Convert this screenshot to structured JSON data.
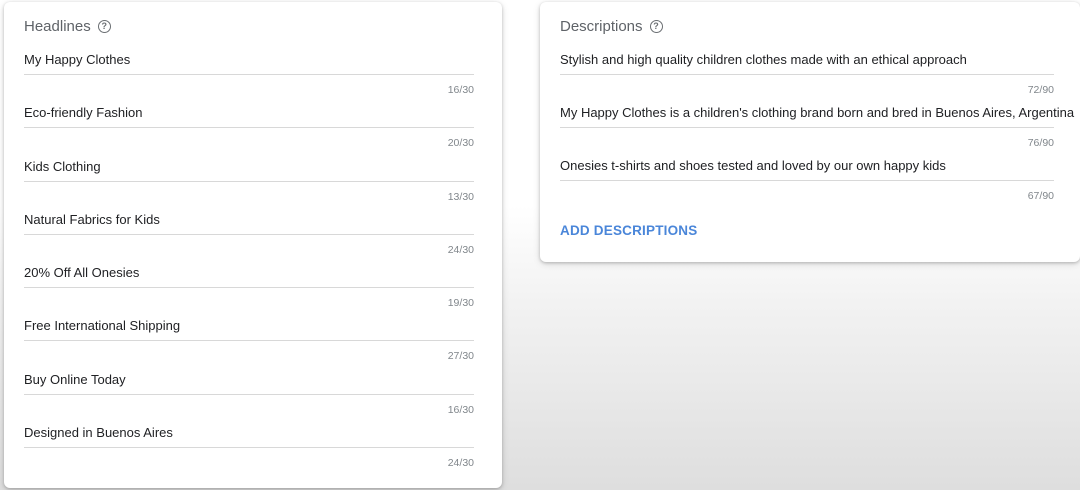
{
  "headlines": {
    "title": "Headlines",
    "help_icon": "help-circle-icon",
    "items": [
      {
        "text": "My Happy Clothes",
        "count": "16/30"
      },
      {
        "text": "Eco-friendly Fashion",
        "count": "20/30"
      },
      {
        "text": "Kids Clothing",
        "count": "13/30"
      },
      {
        "text": "Natural Fabrics for Kids",
        "count": "24/30"
      },
      {
        "text": "20% Off All Onesies",
        "count": "19/30"
      },
      {
        "text": "Free International Shipping",
        "count": "27/30"
      },
      {
        "text": "Buy Online Today",
        "count": "16/30"
      },
      {
        "text": "Designed in Buenos Aires",
        "count": "24/30"
      }
    ]
  },
  "descriptions": {
    "title": "Descriptions",
    "help_icon": "help-circle-icon",
    "items": [
      {
        "text": "Stylish and high quality children clothes made with an ethical approach",
        "count": "72/90"
      },
      {
        "text": "My Happy Clothes is a children's clothing brand born and bred in Buenos Aires, Argentina",
        "count": "76/90"
      },
      {
        "text": "Onesies t-shirts and shoes tested and loved by our own happy kids",
        "count": "67/90"
      }
    ],
    "add_label": "ADD DESCRIPTIONS"
  },
  "colors": {
    "link": "#4a86d9",
    "text": "#202124",
    "muted": "#80868b"
  }
}
